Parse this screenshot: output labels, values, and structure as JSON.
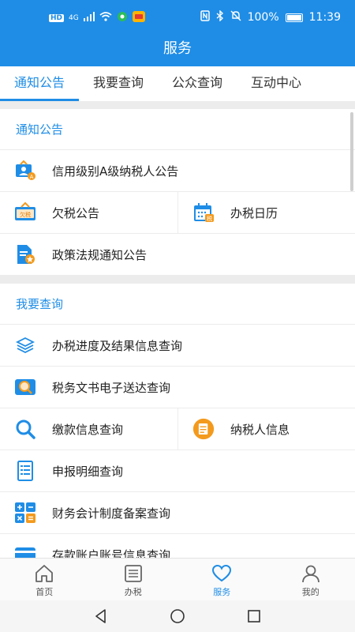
{
  "status_bar": {
    "network_label": "HD",
    "net_gen": "4G",
    "battery": "100%",
    "time": "11:39"
  },
  "header": {
    "title": "服务"
  },
  "tabs": [
    {
      "label": "通知公告",
      "active": true
    },
    {
      "label": "我要查询",
      "active": false
    },
    {
      "label": "公众查询",
      "active": false
    },
    {
      "label": "互动中心",
      "active": false
    }
  ],
  "sections": {
    "notice": {
      "title": "通知公告",
      "items": {
        "credit_a": "信用级别A级纳税人公告",
        "tax_arrears": "欠税公告",
        "tax_calendar": "办税日历",
        "policy_notice": "政策法规通知公告"
      }
    },
    "query": {
      "title": "我要查询",
      "items": {
        "progress": "办税进度及结果信息查询",
        "documents": "税务文书电子送达查询",
        "payment": "缴款信息查询",
        "taxpayer_info": "纳税人信息",
        "declaration": "申报明细查询",
        "accounting": "财务会计制度备案查询",
        "deposit_account": "存款账户账号信息查询"
      }
    }
  },
  "icon_badges": {
    "tax_arrears": "欠税",
    "tax_calendar": "税"
  },
  "bottom_nav": [
    {
      "label": "首页",
      "icon": "home-icon",
      "active": false
    },
    {
      "label": "办税",
      "icon": "list-icon",
      "active": false
    },
    {
      "label": "服务",
      "icon": "heart-icon",
      "active": true
    },
    {
      "label": "我的",
      "icon": "person-icon",
      "active": false
    }
  ],
  "colors": {
    "accent": "#1f8de6",
    "orange": "#f39a1d"
  }
}
